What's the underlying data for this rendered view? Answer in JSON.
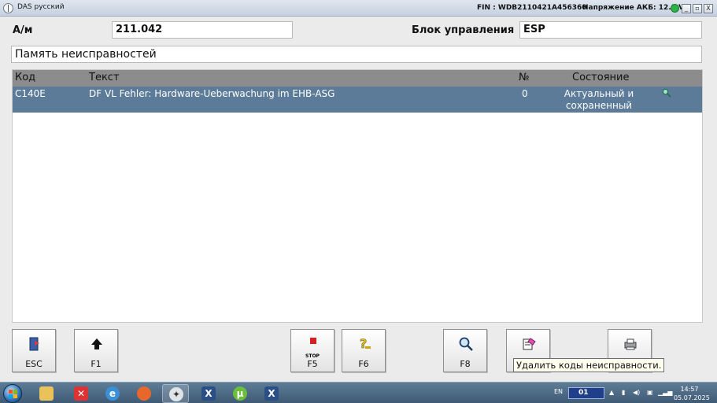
{
  "window": {
    "title": "DAS русский",
    "fin": "FIN : WDB2110421A456360",
    "battery": "Напряжение АКБ: 12.1 V",
    "controls": {
      "minimize": "_",
      "restore": "▫",
      "close": "X"
    }
  },
  "header": {
    "model_label": "А/м",
    "model_value": "211.042",
    "control_unit_label": "Блок управления",
    "control_unit_value": "ESP",
    "section_title": "Память неисправностей"
  },
  "table": {
    "columns": {
      "code": "Код",
      "text": "Текст",
      "number": "№",
      "state": "Состояние"
    },
    "rows": [
      {
        "code": "C140E",
        "text": "DF VL Fehler: Hardware-Ueberwachung im EHB-ASG",
        "number": "0",
        "state_line1": "Актуальный и",
        "state_line2": "сохраненный"
      }
    ]
  },
  "buttons": {
    "esc": "ESC",
    "f1": "F1",
    "f5": "F5",
    "f5_icon_text": "STOP",
    "f6": "F6",
    "f8": "F8"
  },
  "tooltip": "Удалить коды неисправности.",
  "taskbar": {
    "lang": "EN",
    "ime": "01",
    "time": "14:57",
    "date": "05.07.2025"
  },
  "colors": {
    "selected_row": "#5b7b99",
    "header_row": "#8c8c8c",
    "taskbar": "#4a6680"
  }
}
